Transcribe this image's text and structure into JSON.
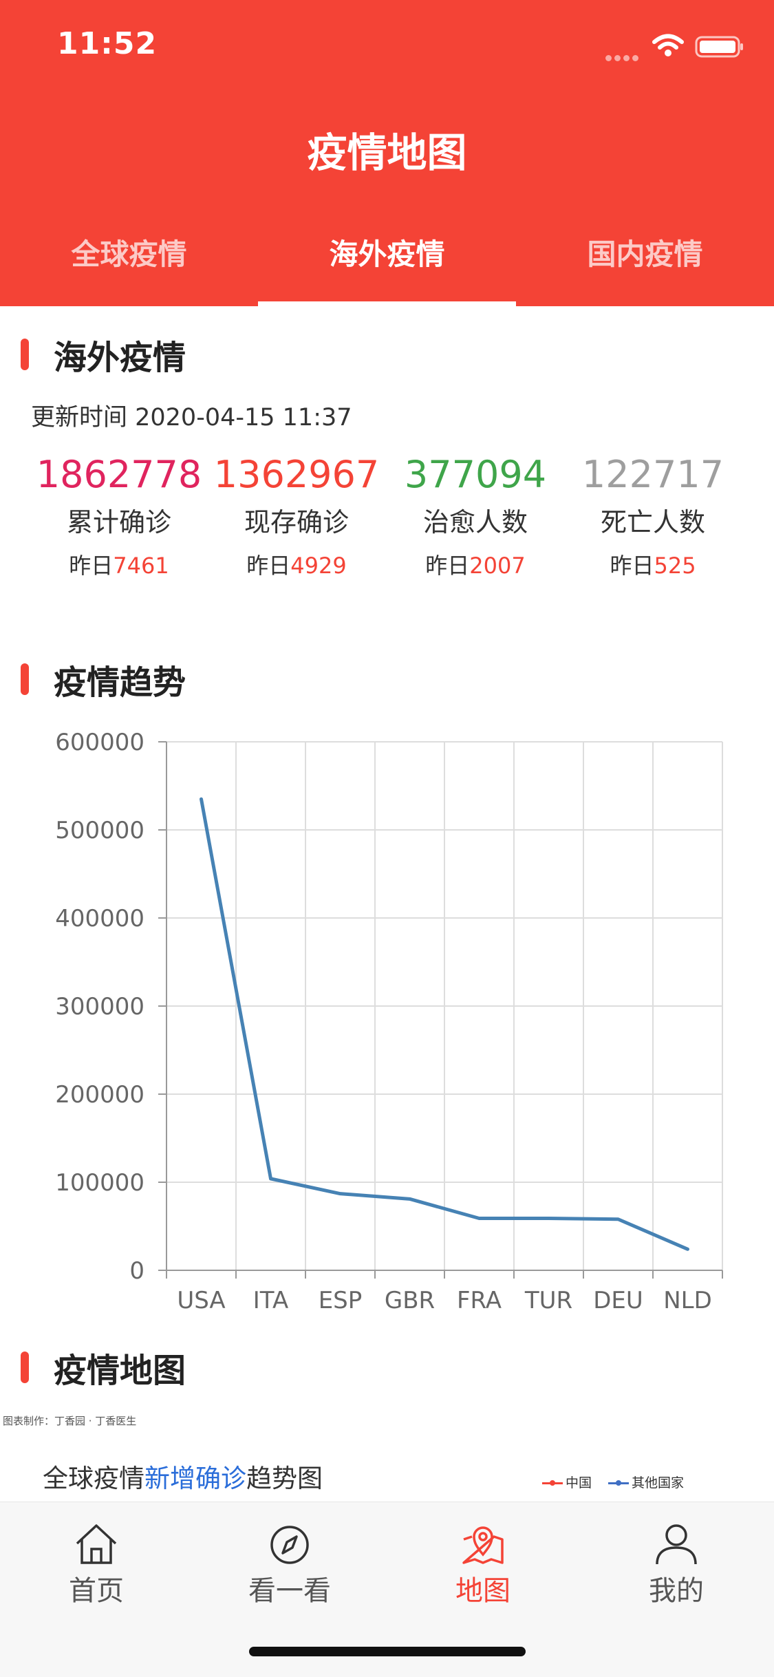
{
  "status_bar": {
    "time": "11:52"
  },
  "header": {
    "title": "疫情地图"
  },
  "tabs": [
    {
      "label": "全球疫情",
      "active": false
    },
    {
      "label": "海外疫情",
      "active": true
    },
    {
      "label": "国内疫情",
      "active": false
    }
  ],
  "overseas": {
    "section_title": "海外疫情",
    "update_time": "更新时间 2020-04-15 11:37",
    "yesterday_prefix": "昨日",
    "stats": [
      {
        "value": "1862778",
        "label": "累计确诊",
        "yesterday": "7461",
        "color": "#e0245e"
      },
      {
        "value": "1362967",
        "label": "现存确诊",
        "yesterday": "4929",
        "color": "#f44336"
      },
      {
        "value": "377094",
        "label": "治愈人数",
        "yesterday": "2007",
        "color": "#3fa54a"
      },
      {
        "value": "122717",
        "label": "死亡人数",
        "yesterday": "525",
        "color": "#9e9e9e"
      }
    ]
  },
  "trend": {
    "section_title": "疫情趋势"
  },
  "chart_data": {
    "type": "line",
    "categories": [
      "USA",
      "ITA",
      "ESP",
      "GBR",
      "FRA",
      "TUR",
      "DEU",
      "NLD"
    ],
    "series": [
      {
        "values": [
          535000,
          104000,
          87000,
          81000,
          59000,
          59000,
          58000,
          24000
        ],
        "color": "#4682b4"
      }
    ],
    "yticks": [
      0,
      100000,
      200000,
      300000,
      400000,
      500000,
      600000
    ],
    "ylim": [
      0,
      600000
    ],
    "grid": true,
    "title": "",
    "xlabel": "",
    "ylabel": ""
  },
  "map": {
    "section_title": "疫情地图",
    "credit": "图表制作：丁香园 · 丁香医生",
    "caption_pre": "全球疫情",
    "caption_highlight": "新增确诊",
    "caption_post": "趋势图",
    "legend": [
      {
        "label": "中国",
        "color": "#f44336"
      },
      {
        "label": "其他国家",
        "color": "#3f6fc4"
      }
    ]
  },
  "tabbar": [
    {
      "label": "首页",
      "icon": "home-icon",
      "active": false
    },
    {
      "label": "看一看",
      "icon": "compass-icon",
      "active": false
    },
    {
      "label": "地图",
      "icon": "map-pin-icon",
      "active": true
    },
    {
      "label": "我的",
      "icon": "user-icon",
      "active": false
    }
  ]
}
